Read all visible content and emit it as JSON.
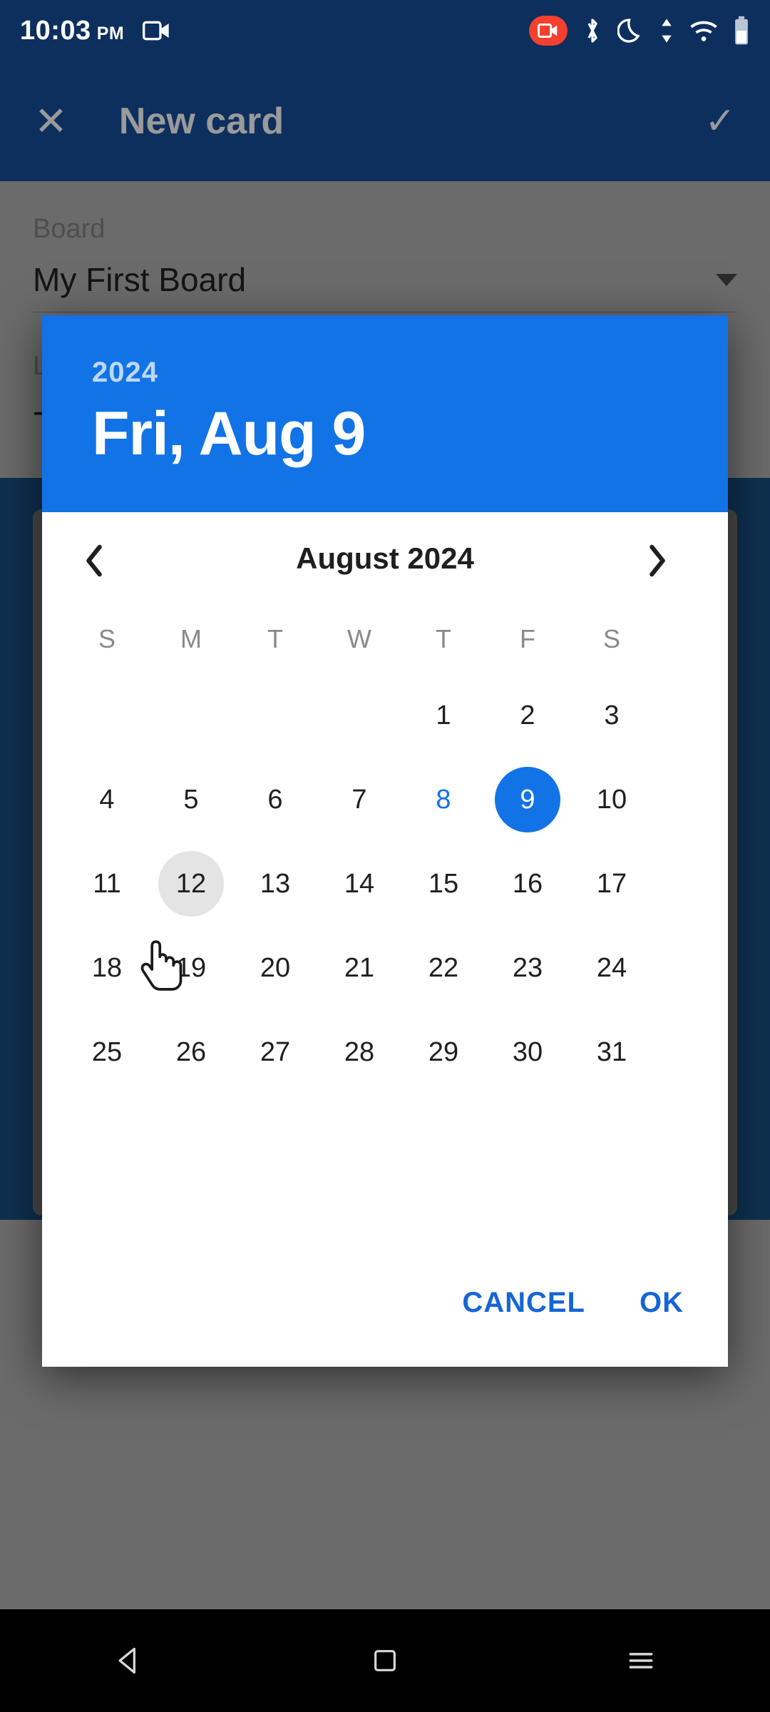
{
  "status_bar": {
    "time": "10:03",
    "ampm": "PM",
    "icons": [
      "screen-record-icon",
      "recording-badge-icon",
      "bluetooth-icon",
      "do-not-disturb-moon-icon",
      "data-transfer-icon",
      "wifi-icon",
      "battery-icon"
    ],
    "recording_color": "#f4402e"
  },
  "app_bar": {
    "close_label": "✕",
    "title": "New card",
    "confirm_label": "✓"
  },
  "form": {
    "board_label": "Board",
    "board_value": "My First Board",
    "list_label": "L",
    "list_value": "-"
  },
  "dialog": {
    "year": "2024",
    "selected_date_text": "Fri, Aug 9",
    "header_color": "#1273e6",
    "month_title": "August 2024",
    "prev_label": "‹",
    "next_label": "›",
    "weekdays": [
      "S",
      "M",
      "T",
      "W",
      "T",
      "F",
      "S"
    ],
    "weeks": [
      [
        null,
        null,
        null,
        null,
        "1",
        "2",
        "3"
      ],
      [
        "4",
        "5",
        "6",
        "7",
        "8",
        "9",
        "10"
      ],
      [
        "11",
        "12",
        "13",
        "14",
        "15",
        "16",
        "17"
      ],
      [
        "18",
        "19",
        "20",
        "21",
        "22",
        "23",
        "24"
      ],
      [
        "25",
        "26",
        "27",
        "28",
        "29",
        "30",
        "31"
      ]
    ],
    "selected_day": "9",
    "today_day": "8",
    "hovered_day": "12",
    "cancel_label": "CANCEL",
    "ok_label": "OK",
    "accent_color": "#1565d8"
  },
  "nav_bar": {
    "back_label": "◁",
    "home_label": "□",
    "recents_label": "☰"
  }
}
